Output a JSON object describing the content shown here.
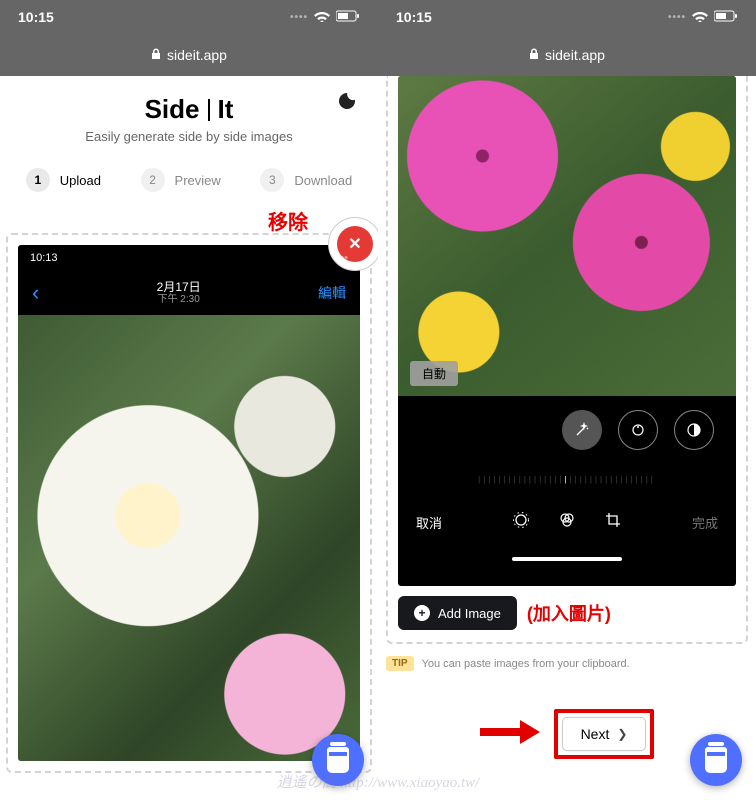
{
  "status": {
    "time": "10:15",
    "url": "sideit.app"
  },
  "left": {
    "title_a": "Side",
    "title_b": "It",
    "subtitle": "Easily generate side by side images",
    "steps": [
      {
        "num": "1",
        "label": "Upload"
      },
      {
        "num": "2",
        "label": "Preview"
      },
      {
        "num": "3",
        "label": "Download"
      }
    ],
    "remove_annotation": "移除",
    "inner": {
      "time": "10:13",
      "date": "2月17日",
      "time_sub": "下午 2:30",
      "back": "‹",
      "edit": "編輯"
    }
  },
  "right": {
    "auto_label": "自動",
    "cancel": "取消",
    "done": "完成",
    "add_image": "Add Image",
    "add_annotation": "(加入圖片)",
    "tip_badge": "TIP",
    "tip_text": "You can paste images from your clipboard.",
    "next": "Next"
  },
  "watermark": "逍遙の窩  http://www.xiaoyao.tw/"
}
